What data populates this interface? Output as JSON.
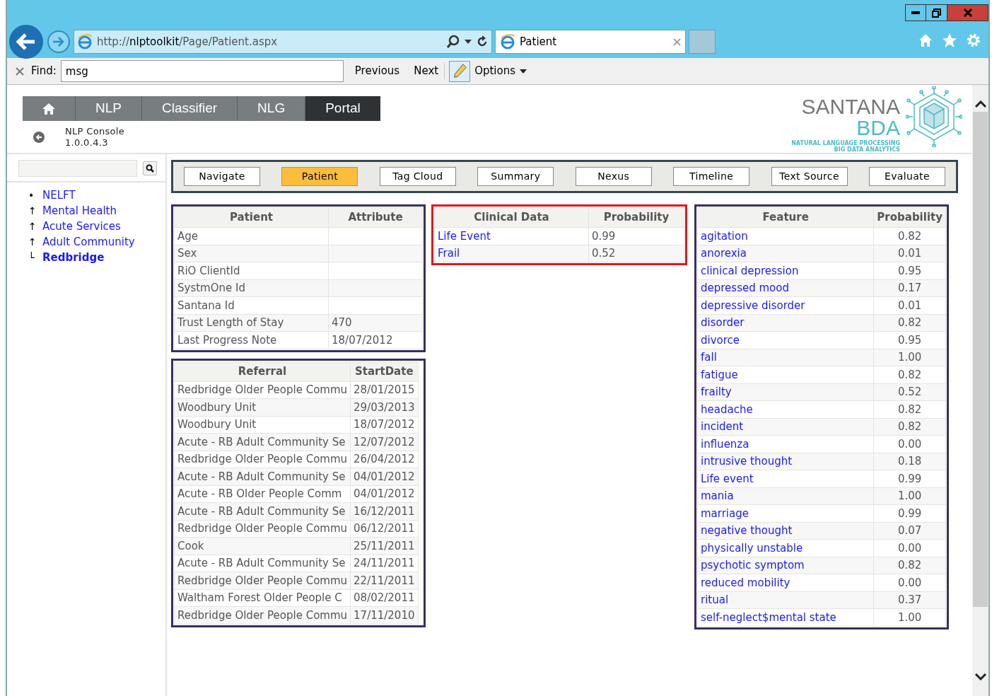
{
  "browser": {
    "address": "http://**nlptoolkit**/Page/Patient.aspx",
    "tab_title": "Patient",
    "find_label": "Find:",
    "find_value": "msg",
    "find_buttons": [
      "Previous",
      "Next"
    ],
    "options": "Options"
  },
  "app_nav": [
    {
      "kind": "home",
      "selected": false
    },
    {
      "kind": "text",
      "label": "NLP",
      "selected": false
    },
    {
      "kind": "text",
      "label": "Classifier",
      "selected": false
    },
    {
      "kind": "text",
      "label": "NLG",
      "selected": false
    },
    {
      "kind": "text",
      "label": "Portal",
      "selected": true
    }
  ],
  "console": {
    "name": "NLP Console",
    "version": "1.0.0.4.3"
  },
  "logo": {
    "name": "SANTANA",
    "sub": "BDA",
    "tagline_1": "NATURAL LANGUAGE PROCESSING",
    "tagline_2": "BIG DATA ANALYTICS"
  },
  "sidebar": {
    "items": [
      {
        "marker": "•",
        "label": "NELFT",
        "current": false
      },
      {
        "marker": "↑",
        "label": "Mental Health",
        "current": false
      },
      {
        "marker": "↑",
        "label": "Acute Services",
        "current": false
      },
      {
        "marker": "↑",
        "label": "Adult Community",
        "current": false
      },
      {
        "marker": "└",
        "label": "Redbridge",
        "current": true
      }
    ]
  },
  "tabs": [
    {
      "label": "Navigate",
      "selected": false
    },
    {
      "label": "Patient",
      "selected": true
    },
    {
      "label": "Tag Cloud",
      "selected": false
    },
    {
      "label": "Summary",
      "selected": false
    },
    {
      "label": "Nexus",
      "selected": false
    },
    {
      "label": "Timeline",
      "selected": false
    },
    {
      "label": "Text Source",
      "selected": false
    },
    {
      "label": "Evaluate",
      "selected": false
    }
  ],
  "patient_table": {
    "columns": [
      "Patient",
      "Attribute"
    ],
    "rows": [
      [
        "Age",
        ""
      ],
      [
        "Sex",
        ""
      ],
      [
        "RiO ClientId",
        ""
      ],
      [
        "SystmOne Id",
        ""
      ],
      [
        "Santana Id",
        ""
      ],
      [
        "Trust Length of Stay",
        "470"
      ],
      [
        "Last Progress Note",
        "18/07/2012"
      ]
    ]
  },
  "clinical_data": {
    "columns": [
      "Clinical Data",
      "Probability"
    ],
    "rows": [
      [
        "Life Event",
        "0.99"
      ],
      [
        "Frail",
        "0.52"
      ]
    ]
  },
  "referrals": {
    "columns": [
      "Referral",
      "StartDate"
    ],
    "rows": [
      [
        "Redbridge Older People Commu",
        "28/01/2015"
      ],
      [
        "Woodbury Unit",
        "29/03/2013"
      ],
      [
        "Woodbury Unit",
        "18/07/2012"
      ],
      [
        "Acute - RB Adult Community Se",
        "12/07/2012"
      ],
      [
        "Redbridge Older People Commu",
        "26/04/2012"
      ],
      [
        "Acute - RB Adult Community Se",
        "04/01/2012"
      ],
      [
        "Acute - RB Older People Comm",
        "04/01/2012"
      ],
      [
        "Acute - RB Adult Community Se",
        "16/12/2011"
      ],
      [
        "Redbridge Older People Commu",
        "06/12/2011"
      ],
      [
        "Cook",
        "25/11/2011"
      ],
      [
        "Acute - RB Adult Community Se",
        "24/11/2011"
      ],
      [
        "Redbridge Older People Commu",
        "22/11/2011"
      ],
      [
        "Waltham Forest Older People C",
        "08/02/2011"
      ],
      [
        "Redbridge Older People Commu",
        "17/11/2010"
      ]
    ]
  },
  "features": {
    "columns": [
      "Feature",
      "Probability"
    ],
    "rows": [
      [
        "agitation",
        "0.82"
      ],
      [
        "anorexia",
        "0.01"
      ],
      [
        "clinical depression",
        "0.95"
      ],
      [
        "depressed mood",
        "0.17"
      ],
      [
        "depressive disorder",
        "0.01"
      ],
      [
        "disorder",
        "0.82"
      ],
      [
        "divorce",
        "0.95"
      ],
      [
        "fall",
        "1.00"
      ],
      [
        "fatigue",
        "0.82"
      ],
      [
        "frailty",
        "0.52"
      ],
      [
        "headache",
        "0.82"
      ],
      [
        "incident",
        "0.82"
      ],
      [
        "influenza",
        "0.00"
      ],
      [
        "intrusive thought",
        "0.18"
      ],
      [
        "Life event",
        "0.99"
      ],
      [
        "mania",
        "1.00"
      ],
      [
        "marriage",
        "0.99"
      ],
      [
        "negative thought",
        "0.07"
      ],
      [
        "physically unstable",
        "0.00"
      ],
      [
        "psychotic symptom",
        "0.82"
      ],
      [
        "reduced mobility",
        "0.00"
      ],
      [
        "ritual",
        "0.37"
      ],
      [
        "self-neglect$mental state",
        "1.00"
      ]
    ]
  }
}
